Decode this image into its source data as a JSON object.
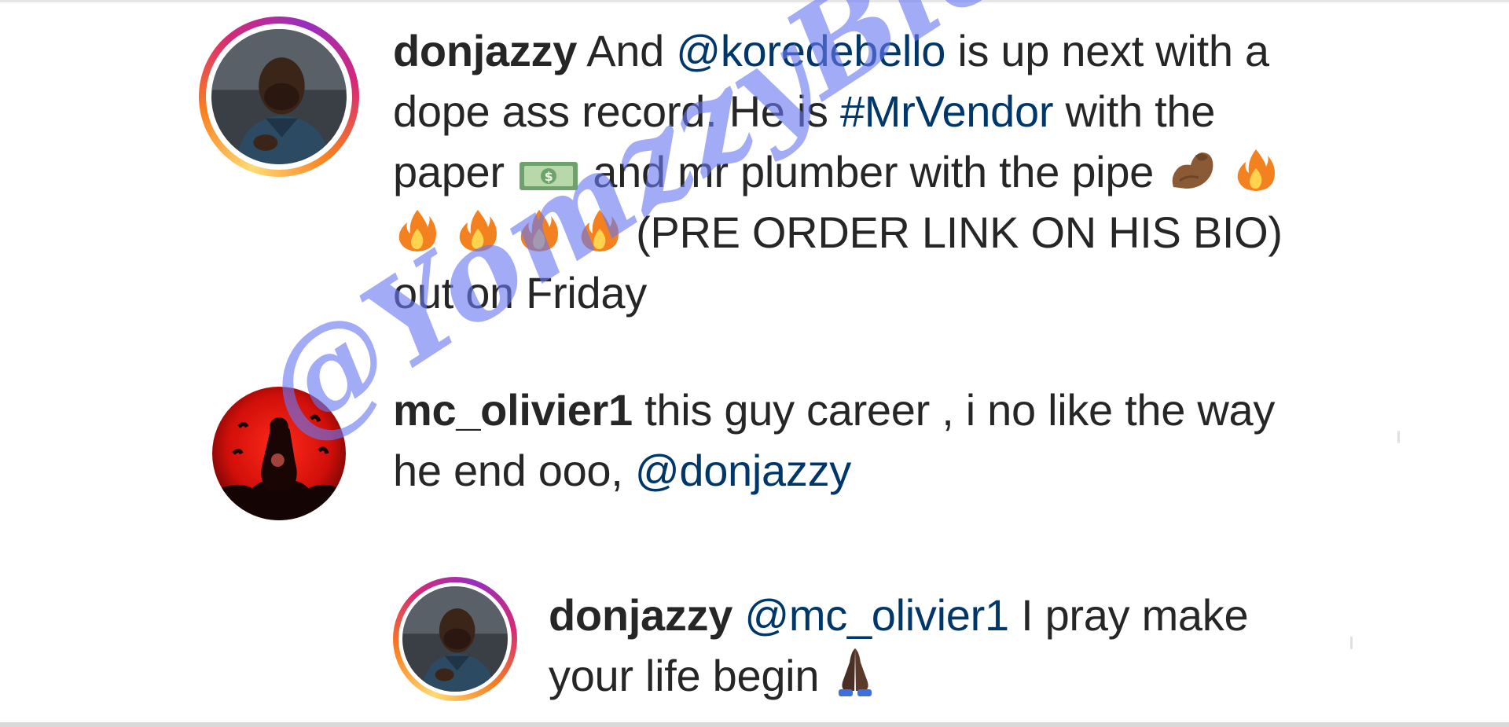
{
  "comments": [
    {
      "username": "donjazzy",
      "parts": {
        "p1": "And",
        "mention": "@koredebello",
        "p2": "is up next with a dope ass record. He is",
        "hashtag": "#MrVendor",
        "p3": "with the paper",
        "p4": "and mr plumber with the pipe",
        "p5": "(PRE ORDER LINK ON HIS BIO) out on Friday"
      },
      "avatar": "donjazzy-avatar",
      "story_ring": true
    },
    {
      "username": "mc_olivier1",
      "parts": {
        "p1": "this guy career , i no like the way he end ooo,",
        "mention": "@donjazzy"
      },
      "avatar": "mc-olivier1-avatar",
      "story_ring": false
    },
    {
      "username": "donjazzy",
      "parts": {
        "mention": "@mc_olivier1",
        "p1": "I pray make your life begin"
      },
      "avatar": "donjazzy-avatar",
      "story_ring": true,
      "is_reply": true
    }
  ],
  "emojis": {
    "money": "money-bill-icon",
    "muscle": "flexed-biceps-icon",
    "fire": "fire-icon",
    "pray": "folded-hands-icon"
  },
  "colors": {
    "text": "#262626",
    "mention": "#00376b",
    "watermark": "#6878f0"
  },
  "watermark": {
    "text": "@YomzzyBlog.com"
  }
}
